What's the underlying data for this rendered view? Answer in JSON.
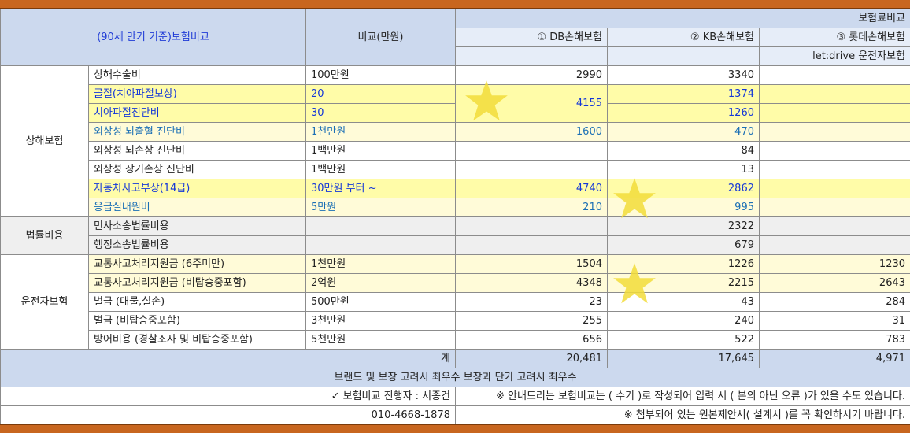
{
  "header": {
    "top_right": "보험료비교",
    "title": "(90세 만기 기준)보험비교",
    "compare_label": "비교(만원)",
    "col_db": "① DB손해보험",
    "col_kb": "② KB손해보험",
    "col_lotte": "③ 롯데손해보험",
    "col_lotte_sub": "let:drive 운전자보험"
  },
  "categories": {
    "injury": "상해보험",
    "legal": "법률비용",
    "driver": "운전자보험"
  },
  "rows": [
    {
      "item": "상해수술비",
      "cmp": "100만원",
      "db": "2990",
      "kb": "3340",
      "lt": ""
    },
    {
      "item": "골절(치아파절보상)",
      "cmp": "20",
      "db": "4155",
      "kb": "1374",
      "lt": ""
    },
    {
      "item": "치아파절진단비",
      "cmp": "30",
      "db": "",
      "kb": "1260",
      "lt": ""
    },
    {
      "item": "외상성 뇌출혈 진단비",
      "cmp": "1천만원",
      "db": "1600",
      "kb": "470",
      "lt": ""
    },
    {
      "item": "외상성 뇌손상 진단비",
      "cmp": "1백만원",
      "db": "",
      "kb": "84",
      "lt": ""
    },
    {
      "item": "외상성 장기손상 진단비",
      "cmp": "1백만원",
      "db": "",
      "kb": "13",
      "lt": ""
    },
    {
      "item": "자동차사고부상(14급)",
      "cmp": "30만원 부터 ~",
      "db": "4740",
      "kb": "2862",
      "lt": ""
    },
    {
      "item": "응급실내원비",
      "cmp": "5만원",
      "db": "210",
      "kb": "995",
      "lt": ""
    },
    {
      "item": "민사소송법률비용",
      "cmp": "",
      "db": "",
      "kb": "2322",
      "lt": ""
    },
    {
      "item": "행정소송법률비용",
      "cmp": "",
      "db": "",
      "kb": "679",
      "lt": ""
    },
    {
      "item": "교통사고처리지원금 (6주미만)",
      "cmp": "1천만원",
      "db": "1504",
      "kb": "1226",
      "lt": "1230"
    },
    {
      "item": "교통사고처리지원금 (비탑승중포함)",
      "cmp": "2억원",
      "db": "4348",
      "kb": "2215",
      "lt": "2643"
    },
    {
      "item": "벌금 (대물,실손)",
      "cmp": "500만원",
      "db": "23",
      "kb": "43",
      "lt": "284"
    },
    {
      "item": "벌금 (비탑승중포함)",
      "cmp": "3천만원",
      "db": "255",
      "kb": "240",
      "lt": "31"
    },
    {
      "item": "방어비용 (경찰조사 및 비탑승중포함)",
      "cmp": "5천만원",
      "db": "656",
      "kb": "522",
      "lt": "783"
    }
  ],
  "total": {
    "label": "계",
    "db": "20,481",
    "kb": "17,645",
    "lt": "4,971"
  },
  "summary": "브랜드 및 보장 고려시 최우수 보장과 단가 고려시 최우수",
  "footer": {
    "manager": "✓ 보험비교 진행자 : 서종건",
    "phone": "010-4668-1878",
    "note1": "※ 안내드리는 보험비교는 ( 수기 )로 작성되어 입력 시 ( 본의 아닌 오류 )가 있을 수도 있습니다.",
    "note2": "※ 첨부되어 있는 원본제안서( 설계서 )를 꼭 확인하시기 바랍니다."
  },
  "colors": {
    "accent_bar": "#c8661f",
    "header_bg": "#ccd9ee",
    "highlight_yellow": "#fffca8",
    "blue_text": "#1437d8",
    "star": "#f2dc3a"
  },
  "icons": [
    "star-sticker-icon",
    "check-icon"
  ]
}
